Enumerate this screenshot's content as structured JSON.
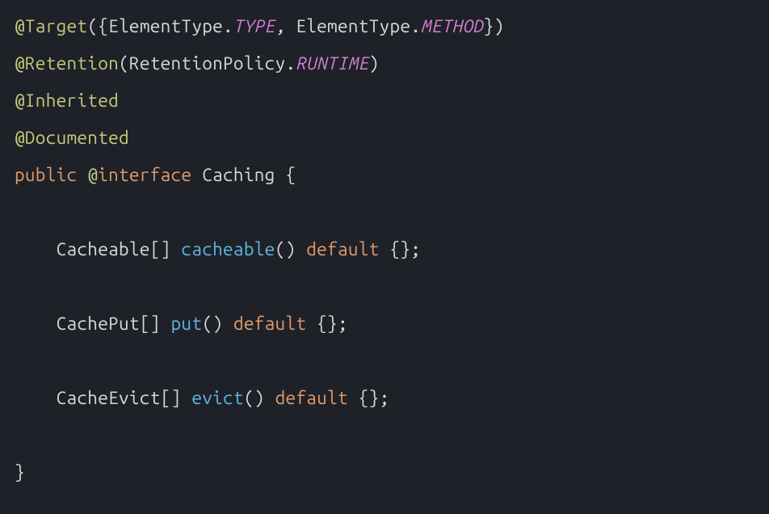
{
  "code": {
    "line1": {
      "at_target": "@Target",
      "lparen": "(",
      "lbrace": "{",
      "et1_class": "ElementType",
      "dot1": ".",
      "type_const": "TYPE",
      "comma_sp": ", ",
      "et2_class": "ElementType",
      "dot2": ".",
      "method_const": "METHOD",
      "rbrace": "}",
      "rparen": ")"
    },
    "line2": {
      "at_retention": "@Retention",
      "lparen": "(",
      "rp_class": "RetentionPolicy",
      "dot": ".",
      "runtime_const": "RUNTIME",
      "rparen": ")"
    },
    "line3": {
      "at_inherited": "@Inherited"
    },
    "line4": {
      "at_documented": "@Documented"
    },
    "line5": {
      "public_kw": "public",
      "space1": " ",
      "at": "@",
      "interface_kw": "interface",
      "space2": " ",
      "name": "Caching",
      "space3": " ",
      "lbrace": "{"
    },
    "line6": {
      "blank": ""
    },
    "line7": {
      "indent": "    ",
      "type": "Cacheable",
      "brackets": "[] ",
      "method": "cacheable",
      "parens": "()",
      "sp1": " ",
      "default_kw": "default",
      "sp2": " ",
      "empty": "{}",
      "semi": ";"
    },
    "line8": {
      "blank": ""
    },
    "line9": {
      "indent": "    ",
      "type": "CachePut",
      "brackets": "[] ",
      "method": "put",
      "parens": "()",
      "sp1": " ",
      "default_kw": "default",
      "sp2": " ",
      "empty": "{}",
      "semi": ";"
    },
    "line10": {
      "blank": ""
    },
    "line11": {
      "indent": "    ",
      "type": "CacheEvict",
      "brackets": "[] ",
      "method": "evict",
      "parens": "()",
      "sp1": " ",
      "default_kw": "default",
      "sp2": " ",
      "empty": "{}",
      "semi": ";"
    },
    "line12": {
      "blank": ""
    },
    "line13": {
      "rbrace": "}"
    }
  }
}
